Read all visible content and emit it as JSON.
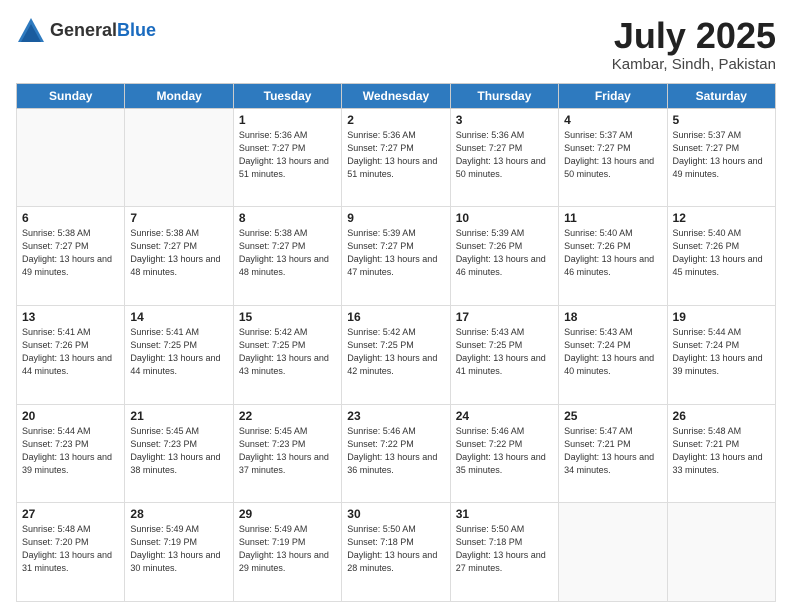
{
  "header": {
    "logo_general": "General",
    "logo_blue": "Blue",
    "title": "July 2025",
    "location": "Kambar, Sindh, Pakistan"
  },
  "days_of_week": [
    "Sunday",
    "Monday",
    "Tuesday",
    "Wednesday",
    "Thursday",
    "Friday",
    "Saturday"
  ],
  "weeks": [
    [
      {
        "day": "",
        "sunrise": "",
        "sunset": "",
        "daylight": ""
      },
      {
        "day": "",
        "sunrise": "",
        "sunset": "",
        "daylight": ""
      },
      {
        "day": "1",
        "sunrise": "Sunrise: 5:36 AM",
        "sunset": "Sunset: 7:27 PM",
        "daylight": "Daylight: 13 hours and 51 minutes."
      },
      {
        "day": "2",
        "sunrise": "Sunrise: 5:36 AM",
        "sunset": "Sunset: 7:27 PM",
        "daylight": "Daylight: 13 hours and 51 minutes."
      },
      {
        "day": "3",
        "sunrise": "Sunrise: 5:36 AM",
        "sunset": "Sunset: 7:27 PM",
        "daylight": "Daylight: 13 hours and 50 minutes."
      },
      {
        "day": "4",
        "sunrise": "Sunrise: 5:37 AM",
        "sunset": "Sunset: 7:27 PM",
        "daylight": "Daylight: 13 hours and 50 minutes."
      },
      {
        "day": "5",
        "sunrise": "Sunrise: 5:37 AM",
        "sunset": "Sunset: 7:27 PM",
        "daylight": "Daylight: 13 hours and 49 minutes."
      }
    ],
    [
      {
        "day": "6",
        "sunrise": "Sunrise: 5:38 AM",
        "sunset": "Sunset: 7:27 PM",
        "daylight": "Daylight: 13 hours and 49 minutes."
      },
      {
        "day": "7",
        "sunrise": "Sunrise: 5:38 AM",
        "sunset": "Sunset: 7:27 PM",
        "daylight": "Daylight: 13 hours and 48 minutes."
      },
      {
        "day": "8",
        "sunrise": "Sunrise: 5:38 AM",
        "sunset": "Sunset: 7:27 PM",
        "daylight": "Daylight: 13 hours and 48 minutes."
      },
      {
        "day": "9",
        "sunrise": "Sunrise: 5:39 AM",
        "sunset": "Sunset: 7:27 PM",
        "daylight": "Daylight: 13 hours and 47 minutes."
      },
      {
        "day": "10",
        "sunrise": "Sunrise: 5:39 AM",
        "sunset": "Sunset: 7:26 PM",
        "daylight": "Daylight: 13 hours and 46 minutes."
      },
      {
        "day": "11",
        "sunrise": "Sunrise: 5:40 AM",
        "sunset": "Sunset: 7:26 PM",
        "daylight": "Daylight: 13 hours and 46 minutes."
      },
      {
        "day": "12",
        "sunrise": "Sunrise: 5:40 AM",
        "sunset": "Sunset: 7:26 PM",
        "daylight": "Daylight: 13 hours and 45 minutes."
      }
    ],
    [
      {
        "day": "13",
        "sunrise": "Sunrise: 5:41 AM",
        "sunset": "Sunset: 7:26 PM",
        "daylight": "Daylight: 13 hours and 44 minutes."
      },
      {
        "day": "14",
        "sunrise": "Sunrise: 5:41 AM",
        "sunset": "Sunset: 7:25 PM",
        "daylight": "Daylight: 13 hours and 44 minutes."
      },
      {
        "day": "15",
        "sunrise": "Sunrise: 5:42 AM",
        "sunset": "Sunset: 7:25 PM",
        "daylight": "Daylight: 13 hours and 43 minutes."
      },
      {
        "day": "16",
        "sunrise": "Sunrise: 5:42 AM",
        "sunset": "Sunset: 7:25 PM",
        "daylight": "Daylight: 13 hours and 42 minutes."
      },
      {
        "day": "17",
        "sunrise": "Sunrise: 5:43 AM",
        "sunset": "Sunset: 7:25 PM",
        "daylight": "Daylight: 13 hours and 41 minutes."
      },
      {
        "day": "18",
        "sunrise": "Sunrise: 5:43 AM",
        "sunset": "Sunset: 7:24 PM",
        "daylight": "Daylight: 13 hours and 40 minutes."
      },
      {
        "day": "19",
        "sunrise": "Sunrise: 5:44 AM",
        "sunset": "Sunset: 7:24 PM",
        "daylight": "Daylight: 13 hours and 39 minutes."
      }
    ],
    [
      {
        "day": "20",
        "sunrise": "Sunrise: 5:44 AM",
        "sunset": "Sunset: 7:23 PM",
        "daylight": "Daylight: 13 hours and 39 minutes."
      },
      {
        "day": "21",
        "sunrise": "Sunrise: 5:45 AM",
        "sunset": "Sunset: 7:23 PM",
        "daylight": "Daylight: 13 hours and 38 minutes."
      },
      {
        "day": "22",
        "sunrise": "Sunrise: 5:45 AM",
        "sunset": "Sunset: 7:23 PM",
        "daylight": "Daylight: 13 hours and 37 minutes."
      },
      {
        "day": "23",
        "sunrise": "Sunrise: 5:46 AM",
        "sunset": "Sunset: 7:22 PM",
        "daylight": "Daylight: 13 hours and 36 minutes."
      },
      {
        "day": "24",
        "sunrise": "Sunrise: 5:46 AM",
        "sunset": "Sunset: 7:22 PM",
        "daylight": "Daylight: 13 hours and 35 minutes."
      },
      {
        "day": "25",
        "sunrise": "Sunrise: 5:47 AM",
        "sunset": "Sunset: 7:21 PM",
        "daylight": "Daylight: 13 hours and 34 minutes."
      },
      {
        "day": "26",
        "sunrise": "Sunrise: 5:48 AM",
        "sunset": "Sunset: 7:21 PM",
        "daylight": "Daylight: 13 hours and 33 minutes."
      }
    ],
    [
      {
        "day": "27",
        "sunrise": "Sunrise: 5:48 AM",
        "sunset": "Sunset: 7:20 PM",
        "daylight": "Daylight: 13 hours and 31 minutes."
      },
      {
        "day": "28",
        "sunrise": "Sunrise: 5:49 AM",
        "sunset": "Sunset: 7:19 PM",
        "daylight": "Daylight: 13 hours and 30 minutes."
      },
      {
        "day": "29",
        "sunrise": "Sunrise: 5:49 AM",
        "sunset": "Sunset: 7:19 PM",
        "daylight": "Daylight: 13 hours and 29 minutes."
      },
      {
        "day": "30",
        "sunrise": "Sunrise: 5:50 AM",
        "sunset": "Sunset: 7:18 PM",
        "daylight": "Daylight: 13 hours and 28 minutes."
      },
      {
        "day": "31",
        "sunrise": "Sunrise: 5:50 AM",
        "sunset": "Sunset: 7:18 PM",
        "daylight": "Daylight: 13 hours and 27 minutes."
      },
      {
        "day": "",
        "sunrise": "",
        "sunset": "",
        "daylight": ""
      },
      {
        "day": "",
        "sunrise": "",
        "sunset": "",
        "daylight": ""
      }
    ]
  ]
}
